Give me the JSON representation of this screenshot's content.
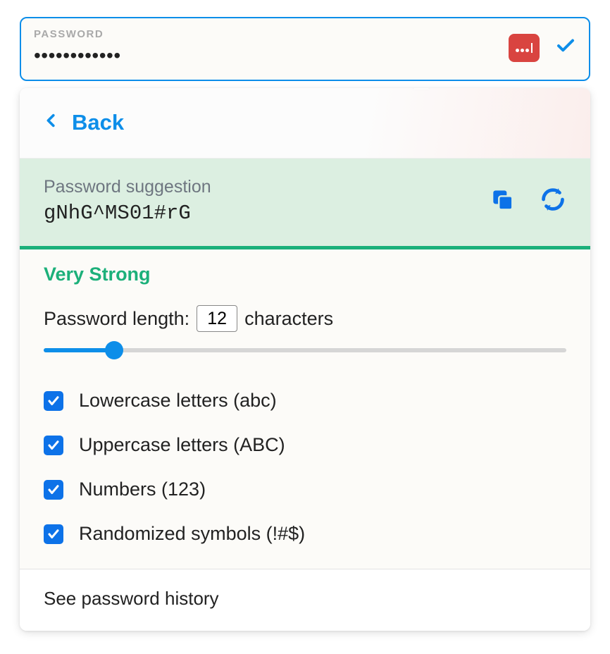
{
  "field": {
    "label": "PASSWORD",
    "masked_value": "••••••••••••"
  },
  "panel": {
    "back_label": "Back",
    "suggestion_label": "Password suggestion",
    "suggestion_value": "gNhG^MS01#rG",
    "strength_label": "Very Strong",
    "length_prefix": "Password length:",
    "length_value": "12",
    "length_suffix": "characters",
    "options": [
      {
        "label": "Lowercase letters (abc)",
        "checked": true
      },
      {
        "label": "Uppercase letters (ABC)",
        "checked": true
      },
      {
        "label": "Numbers (123)",
        "checked": true
      },
      {
        "label": "Randomized symbols (!#$)",
        "checked": true
      }
    ],
    "history_label": "See password history"
  }
}
